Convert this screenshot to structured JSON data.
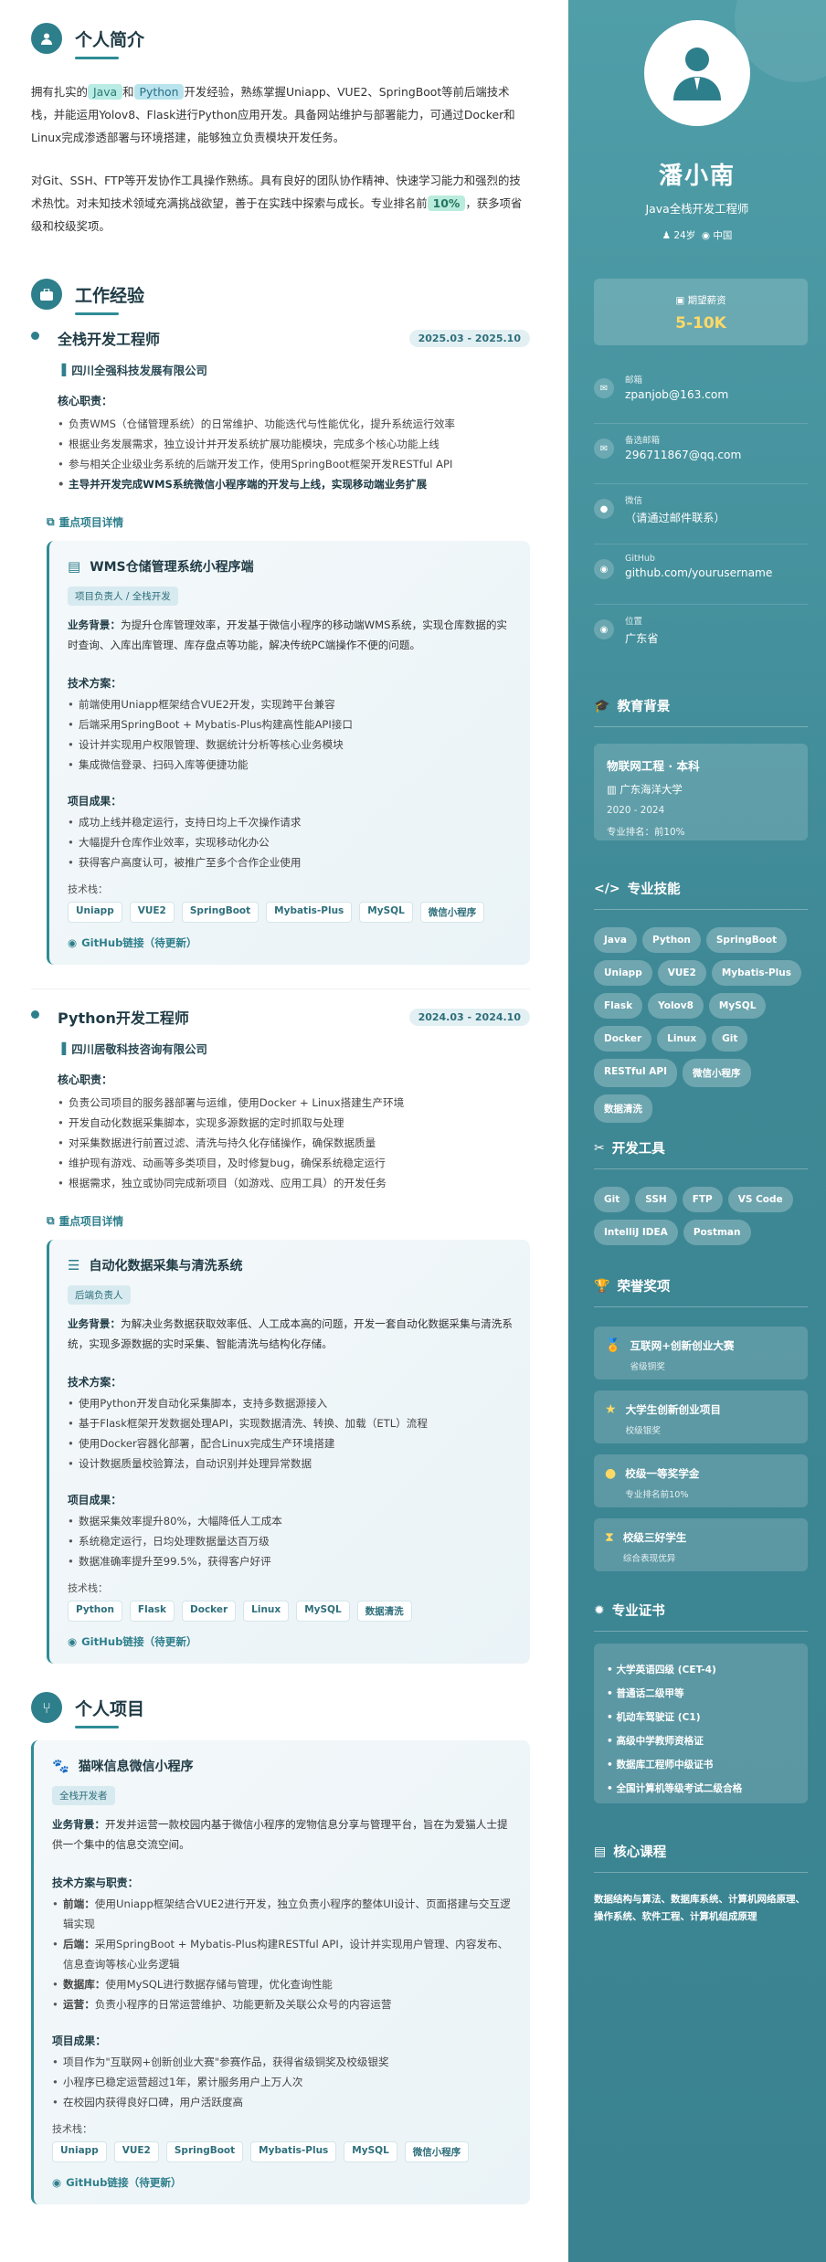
{
  "intro": {
    "title": "个人简介",
    "p1_a": "拥有扎实的",
    "p1_java": "Java",
    "p1_and": "和",
    "p1_python": "Python",
    "p1_b": "开发经验，熟练掌握Uniapp、VUE2、SpringBoot等前后端技术栈，并能运用Yolov8、Flask进行Python应用开发。具备网站维护与部署能力，可通过Docker和Linux完成渗透部署与环境搭建，能够独立负责模块开发任务。",
    "p2_a": "对Git、SSH、FTP等开发协作工具操作熟练。具有良好的团队协作精神、快速学习能力和强烈的技术热忱。对未知技术领域充满挑战欲望，善于在实践中探索与成长。专业排名前",
    "p2_rank": "10%",
    "p2_b": "，获多项省级和校级奖项。"
  },
  "work": {
    "title": "工作经验",
    "jobs": [
      {
        "title": "全栈开发工程师",
        "date": "2025.03 - 2025.10",
        "company": "四川全强科技发展有限公司",
        "duties_label": "核心职责：",
        "duties": [
          "负责WMS（仓储管理系统）的日常维护、功能迭代与性能优化，提升系统运行效率",
          "根据业务发展需求，独立设计并开发系统扩展功能模块，完成多个核心功能上线",
          "参与相关企业级业务系统的后端开发工作，使用SpringBoot框架开发RESTful API",
          "主导并开发完成WMS系统微信小程序端的开发与上线，实现移动端业务扩展"
        ],
        "proj_label": "重点项目详情",
        "proj": {
          "title": "WMS仓储管理系统小程序端",
          "role": "项目负责人 / 全栈开发",
          "bg_label": "业务背景：",
          "bg": "为提升仓库管理效率，开发基于微信小程序的移动端WMS系统，实现仓库数据的实时查询、入库出库管理、库存盘点等功能，解决传统PC端操作不便的问题。",
          "tech_label": "技术方案：",
          "tech": [
            "前端使用Uniapp框架结合VUE2开发，实现跨平台兼容",
            "后端采用SpringBoot + Mybatis-Plus构建高性能API接口",
            "设计并实现用户权限管理、数据统计分析等核心业务模块",
            "集成微信登录、扫码入库等便捷功能"
          ],
          "result_label": "项目成果：",
          "results": [
            "成功上线并稳定运行，支持日均上千次操作请求",
            "大幅提升仓库作业效率，实现移动化办公",
            "获得客户高度认可，被推广至多个合作企业使用"
          ],
          "stack_label": "技术栈：",
          "stack": [
            "Uniapp",
            "VUE2",
            "SpringBoot",
            "Mybatis-Plus",
            "MySQL",
            "微信小程序"
          ],
          "github": "GitHub链接（待更新）"
        }
      },
      {
        "title": "Python开发工程师",
        "date": "2024.03 - 2024.10",
        "company": "四川居敬科技咨询有限公司",
        "duties_label": "核心职责：",
        "duties": [
          "负责公司项目的服务器部署与运维，使用Docker + Linux搭建生产环境",
          "开发自动化数据采集脚本，实现多源数据的定时抓取与处理",
          "对采集数据进行前置过滤、清洗与持久化存储操作，确保数据质量",
          "维护现有游戏、动画等多类项目，及时修复bug，确保系统稳定运行",
          "根据需求，独立或协同完成新项目（如游戏、应用工具）的开发任务"
        ],
        "proj_label": "重点项目详情",
        "proj": {
          "title": "自动化数据采集与清洗系统",
          "role": "后端负责人",
          "bg_label": "业务背景：",
          "bg": "为解决业务数据获取效率低、人工成本高的问题，开发一套自动化数据采集与清洗系统，实现多源数据的实时采集、智能清洗与结构化存储。",
          "tech_label": "技术方案：",
          "tech": [
            "使用Python开发自动化采集脚本，支持多数据源接入",
            "基于Flask框架开发数据处理API，实现数据清洗、转换、加载（ETL）流程",
            "使用Docker容器化部署，配合Linux完成生产环境搭建",
            "设计数据质量校验算法，自动识别并处理异常数据"
          ],
          "result_label": "项目成果：",
          "results": [
            "数据采集效率提升80%，大幅降低人工成本",
            "系统稳定运行，日均处理数据量达百万级",
            "数据准确率提升至99.5%，获得客户好评"
          ],
          "stack_label": "技术栈：",
          "stack": [
            "Python",
            "Flask",
            "Docker",
            "Linux",
            "MySQL",
            "数据清洗"
          ],
          "github": "GitHub链接（待更新）"
        }
      }
    ]
  },
  "personal": {
    "title": "个人项目",
    "proj": {
      "title": "猫咪信息微信小程序",
      "role": "全栈开发者",
      "bg_label": "业务背景：",
      "bg": "开发并运营一款校园内基于微信小程序的宠物信息分享与管理平台，旨在为爱猫人士提供一个集中的信息交流空间。",
      "tech_label": "技术方案与职责：",
      "tech": [
        {
          "k": "前端：",
          "v": "使用Uniapp框架结合VUE2进行开发，独立负责小程序的整体UI设计、页面搭建与交互逻辑实现"
        },
        {
          "k": "后端：",
          "v": "采用SpringBoot + Mybatis-Plus构建RESTful API，设计并实现用户管理、内容发布、信息查询等核心业务逻辑"
        },
        {
          "k": "数据库：",
          "v": "使用MySQL进行数据存储与管理，优化查询性能"
        },
        {
          "k": "运营：",
          "v": "负责小程序的日常运营维护、功能更新及关联公众号的内容运营"
        }
      ],
      "result_label": "项目成果：",
      "results": [
        "项目作为\"互联网+创新创业大赛\"参赛作品，获得省级铜奖及校级银奖",
        "小程序已稳定运营超过1年，累计服务用户上万人次",
        "在校园内获得良好口碑，用户活跃度高"
      ],
      "stack_label": "技术栈：",
      "stack": [
        "Uniapp",
        "VUE2",
        "SpringBoot",
        "Mybatis-Plus",
        "MySQL",
        "微信小程序"
      ],
      "github": "GitHub链接（待更新）"
    }
  },
  "side": {
    "name": "潘小南",
    "job": "Java全栈开发工程师",
    "age": "24岁",
    "location": "中国",
    "salary_label": "期望薪资",
    "salary": "5-10K",
    "contacts": [
      {
        "k": "邮箱",
        "v": "zpanjob@163.com"
      },
      {
        "k": "备选邮箱",
        "v": "296711867@qq.com"
      },
      {
        "k": "微信",
        "v": "（请通过邮件联系）"
      },
      {
        "k": "GitHub",
        "v": "github.com/yourusername"
      },
      {
        "k": "位置",
        "v": "广东省"
      }
    ],
    "edu_title": "教育背景",
    "edu": {
      "major": "物联网工程 · 本科",
      "school": "广东海洋大学",
      "years": "2020 - 2024",
      "rank": "专业排名：前10%"
    },
    "skills_title": "专业技能",
    "skills": [
      "Java",
      "Python",
      "SpringBoot",
      "Uniapp",
      "VUE2",
      "Mybatis-Plus",
      "Flask",
      "Yolov8",
      "MySQL",
      "Docker",
      "Linux",
      "Git",
      "RESTful API",
      "微信小程序",
      "数据清洗"
    ],
    "tools_title": "开发工具",
    "tools": [
      "Git",
      "SSH",
      "FTP",
      "VS Code",
      "IntelliJ IDEA",
      "Postman"
    ],
    "awards_title": "荣誉奖项",
    "awards": [
      {
        "a": "互联网+创新创业大赛",
        "b": "省级铜奖"
      },
      {
        "a": "大学生创新创业项目",
        "b": "校级银奖"
      },
      {
        "a": "校级一等奖学金",
        "b": "专业排名前10%"
      },
      {
        "a": "校级三好学生",
        "b": "综合表现优异"
      }
    ],
    "certs_title": "专业证书",
    "certs": [
      "大学英语四级 (CET-4)",
      "普通话二级甲等",
      "机动车驾驶证 (C1)",
      "高级中学教师资格证",
      "数据库工程师中级证书",
      "全国计算机等级考试二级合格"
    ],
    "courses_title": "核心课程",
    "courses": "数据结构与算法、数据库系统、计算机网络原理、操作系统、软件工程、计算机组成原理"
  },
  "colors": {
    "accent": "#2e7f8c",
    "sidebar": "#3e8895",
    "gold": "#ffd966"
  }
}
